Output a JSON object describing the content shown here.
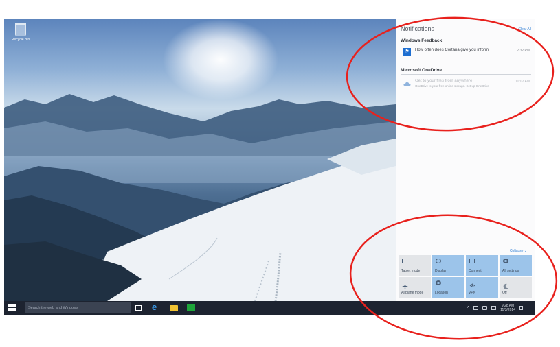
{
  "desktop": {
    "recycle_bin_label": "Recycle Bin"
  },
  "taskbar": {
    "search_placeholder": "Search the web and Windows",
    "clock_time": "9:28 AM",
    "clock_date": "11/3/2014"
  },
  "action_center": {
    "title": "Notifications",
    "clear_all": "Clear All",
    "groups": [
      {
        "name": "Windows Feedback",
        "notifications": [
          {
            "text": "How often does Cortana give you inform",
            "time": "2:32 PM"
          }
        ]
      },
      {
        "name": "Microsoft OneDrive",
        "notifications": [
          {
            "text": "Get to your files from anywhere",
            "subtext": "OneDrive is your free online storage. Set up OneDrive",
            "time": "10:02 AM"
          }
        ]
      }
    ],
    "collapse_label": "Collapse",
    "quick_actions": [
      {
        "label": "Tablet mode",
        "active": false
      },
      {
        "label": "Display",
        "active": true
      },
      {
        "label": "Connect",
        "active": true
      },
      {
        "label": "All settings",
        "active": true
      },
      {
        "label": "Airplane mode",
        "active": false
      },
      {
        "label": "Location",
        "active": true
      },
      {
        "label": "VPN",
        "active": true
      },
      {
        "label": "Off",
        "active": false
      }
    ]
  },
  "colors": {
    "annotation": "#e8211d",
    "taskbar": "#1d2330",
    "tile_active": "#9cc4ea",
    "accent": "#2b7cd3"
  }
}
